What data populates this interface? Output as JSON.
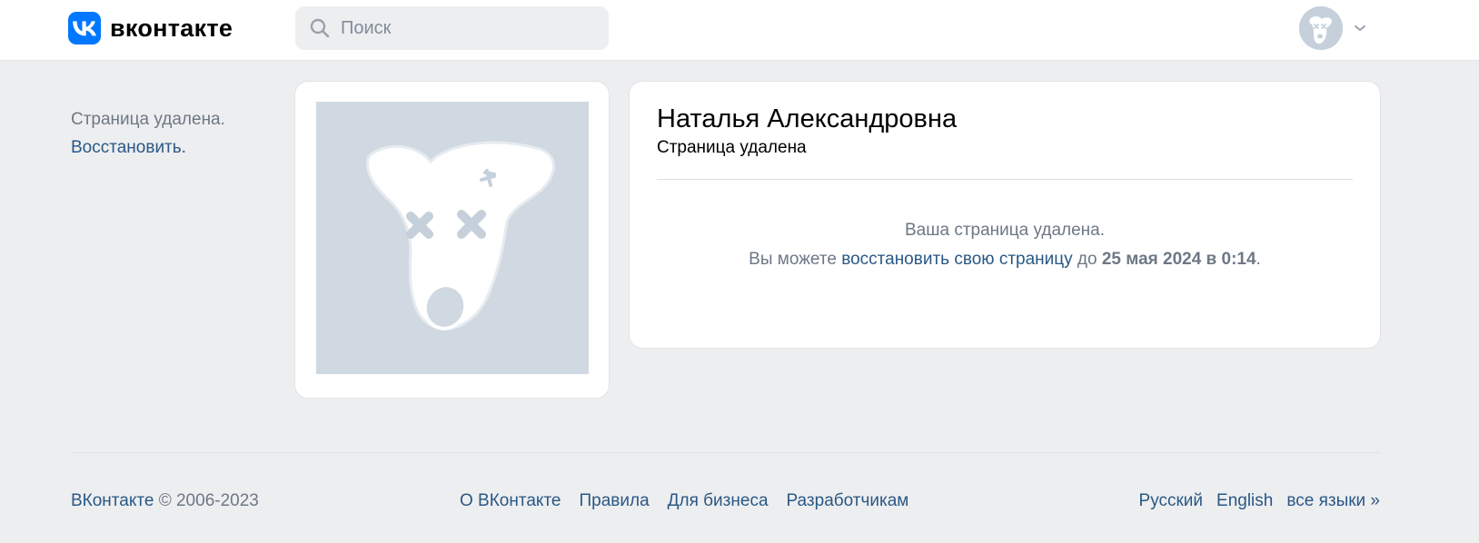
{
  "header": {
    "logo_text": "вконтакте",
    "search_placeholder": "Поиск"
  },
  "sidebar_note": {
    "status": "Страница удалена.",
    "restore_link": "Восстановить."
  },
  "profile": {
    "name": "Наталья Александровна",
    "status": "Страница удалена"
  },
  "message": {
    "line1": "Ваша страница удалена.",
    "line2_prefix": "Вы можете ",
    "restore_link": "восстановить свою страницу",
    "line2_mid": " до ",
    "deadline": "25 мая 2024 в 0:14",
    "line2_suffix": "."
  },
  "footer": {
    "brand": "ВКонтакте",
    "copyright": " © 2006-2023",
    "links": [
      "О ВКонтакте",
      "Правила",
      "Для бизнеса",
      "Разработчикам"
    ],
    "languages": [
      "Русский",
      "English",
      "все языки »"
    ]
  },
  "colors": {
    "brand": "#0077ff",
    "link": "#2a5885",
    "muted": "#6d7885",
    "page_bg": "#edeef0",
    "deactivated_photo_bg": "#d0d8e1"
  },
  "icons": {
    "logo": "vk-logo-icon",
    "search": "search-icon",
    "avatar": "deactivated-dog-avatar",
    "chevron": "chevron-down-icon",
    "photo": "deactivated-dog-photo"
  }
}
